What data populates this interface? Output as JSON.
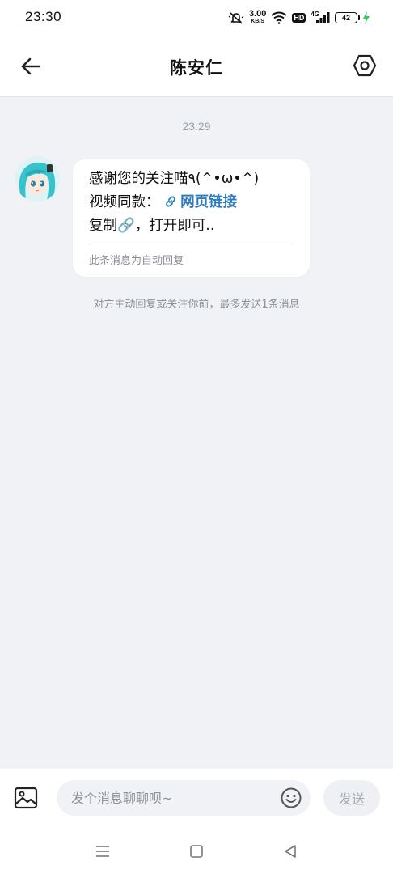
{
  "status_bar": {
    "time": "23:30",
    "speed_value": "3.00",
    "speed_unit": "KB/S",
    "hd": "HD",
    "network": "4G",
    "battery": "42",
    "charging_color": "#34c759"
  },
  "header": {
    "title": "陈安仁",
    "back_icon": "arrow-left-icon",
    "settings_icon": "hexagon-settings-icon"
  },
  "chat": {
    "timestamp": "23:29",
    "message": {
      "line1": "感谢您的关注喵٩(^•ω•^)",
      "line2_prefix": "视频同款：",
      "link_text": "网页链接",
      "line3": "复制🔗，打开即可..",
      "auto_reply_note": "此条消息为自动回复"
    },
    "hint": "对方主动回复或关注你前，最多发送1条消息"
  },
  "input_bar": {
    "placeholder": "发个消息聊聊呗~",
    "send_label": "发送",
    "image_icon": "image-icon",
    "emoji_icon": "emoji-icon"
  },
  "nav": {
    "menu_icon": "menu-icon",
    "home_icon": "home-square-icon",
    "back_icon": "back-triangle-icon"
  },
  "colors": {
    "background": "#f0f2f5",
    "link": "#2e7bbd",
    "muted": "#8c9097"
  }
}
